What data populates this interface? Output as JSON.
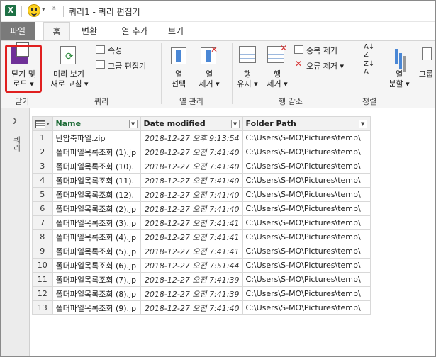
{
  "titlebar": {
    "app_icon": "X",
    "title": "쿼리1 - 쿼리 편집기",
    "icons": [
      "excel-logo",
      "smiley-icon",
      "dropdown-icon",
      "customize-icon"
    ]
  },
  "tabs": {
    "file": "파일",
    "home": "홈",
    "transform": "변환",
    "add_column": "열 추가",
    "view": "보기"
  },
  "ribbon": {
    "close_load_line1": "닫기 및",
    "close_load_line2": "로드 ▾",
    "close_group": "닫기",
    "refresh_line1": "미리 보기",
    "refresh_line2": "새로 고침 ▾",
    "properties": "속성",
    "advanced_editor": "고급 편집기",
    "query_group": "쿼리",
    "select_columns_line1": "열",
    "select_columns_line2": "선택",
    "remove_columns_line1": "열",
    "remove_columns_line2": "제거 ▾",
    "column_mgmt_group": "열 관리",
    "keep_rows_line1": "행",
    "keep_rows_line2": "유지 ▾",
    "remove_rows_line1": "행",
    "remove_rows_line2": "제거 ▾",
    "remove_duplicates": "중복 제거",
    "remove_errors": "오류 제거 ▾",
    "reduce_rows_group": "행 감소",
    "sort_group": "정렬",
    "split_column_line1": "열",
    "split_column_line2": "분할 ▾",
    "group_by": "그룹"
  },
  "queries_pane": {
    "label": "쿼리"
  },
  "table": {
    "headers": [
      "Name",
      "Date modified",
      "Folder Path"
    ],
    "rows": [
      {
        "n": "1",
        "name": "난압축파일.zip",
        "date": "2018-12-27 오후 9:13:54",
        "path": "C:\\Users\\S-MO\\Pictures\\temp\\"
      },
      {
        "n": "2",
        "name": "폴더파일목록조회 (1).jp",
        "date": "2018-12-27 오전 7:41:40",
        "path": "C:\\Users\\S-MO\\Pictures\\temp\\"
      },
      {
        "n": "3",
        "name": "폴더파일목록조회 (10).",
        "date": "2018-12-27 오전 7:41:40",
        "path": "C:\\Users\\S-MO\\Pictures\\temp\\"
      },
      {
        "n": "4",
        "name": "폴더파일목록조회 (11).",
        "date": "2018-12-27 오전 7:41:40",
        "path": "C:\\Users\\S-MO\\Pictures\\temp\\"
      },
      {
        "n": "5",
        "name": "폴더파일목록조회 (12).",
        "date": "2018-12-27 오전 7:41:40",
        "path": "C:\\Users\\S-MO\\Pictures\\temp\\"
      },
      {
        "n": "6",
        "name": "폴더파일목록조회 (2).jp",
        "date": "2018-12-27 오전 7:41:40",
        "path": "C:\\Users\\S-MO\\Pictures\\temp\\"
      },
      {
        "n": "7",
        "name": "폴더파일목록조회 (3).jp",
        "date": "2018-12-27 오전 7:41:41",
        "path": "C:\\Users\\S-MO\\Pictures\\temp\\"
      },
      {
        "n": "8",
        "name": "폴더파일목록조회 (4).jp",
        "date": "2018-12-27 오전 7:41:41",
        "path": "C:\\Users\\S-MO\\Pictures\\temp\\"
      },
      {
        "n": "9",
        "name": "폴더파일목록조회 (5).jp",
        "date": "2018-12-27 오전 7:41:41",
        "path": "C:\\Users\\S-MO\\Pictures\\temp\\"
      },
      {
        "n": "10",
        "name": "폴더파일목록조회 (6).jp",
        "date": "2018-12-27 오전 7:51:44",
        "path": "C:\\Users\\S-MO\\Pictures\\temp\\"
      },
      {
        "n": "11",
        "name": "폴더파일목록조회 (7).jp",
        "date": "2018-12-27 오전 7:41:39",
        "path": "C:\\Users\\S-MO\\Pictures\\temp\\"
      },
      {
        "n": "12",
        "name": "폴더파일목록조회 (8).jp",
        "date": "2018-12-27 오전 7:41:39",
        "path": "C:\\Users\\S-MO\\Pictures\\temp\\"
      },
      {
        "n": "13",
        "name": "폴더파일목록조회 (9).jp",
        "date": "2018-12-27 오전 7:41:40",
        "path": "C:\\Users\\S-MO\\Pictures\\temp\\"
      }
    ]
  },
  "colors": {
    "accent_green": "#1e7145",
    "highlight_red": "#e02020",
    "file_tab": "#7a7a7a"
  }
}
